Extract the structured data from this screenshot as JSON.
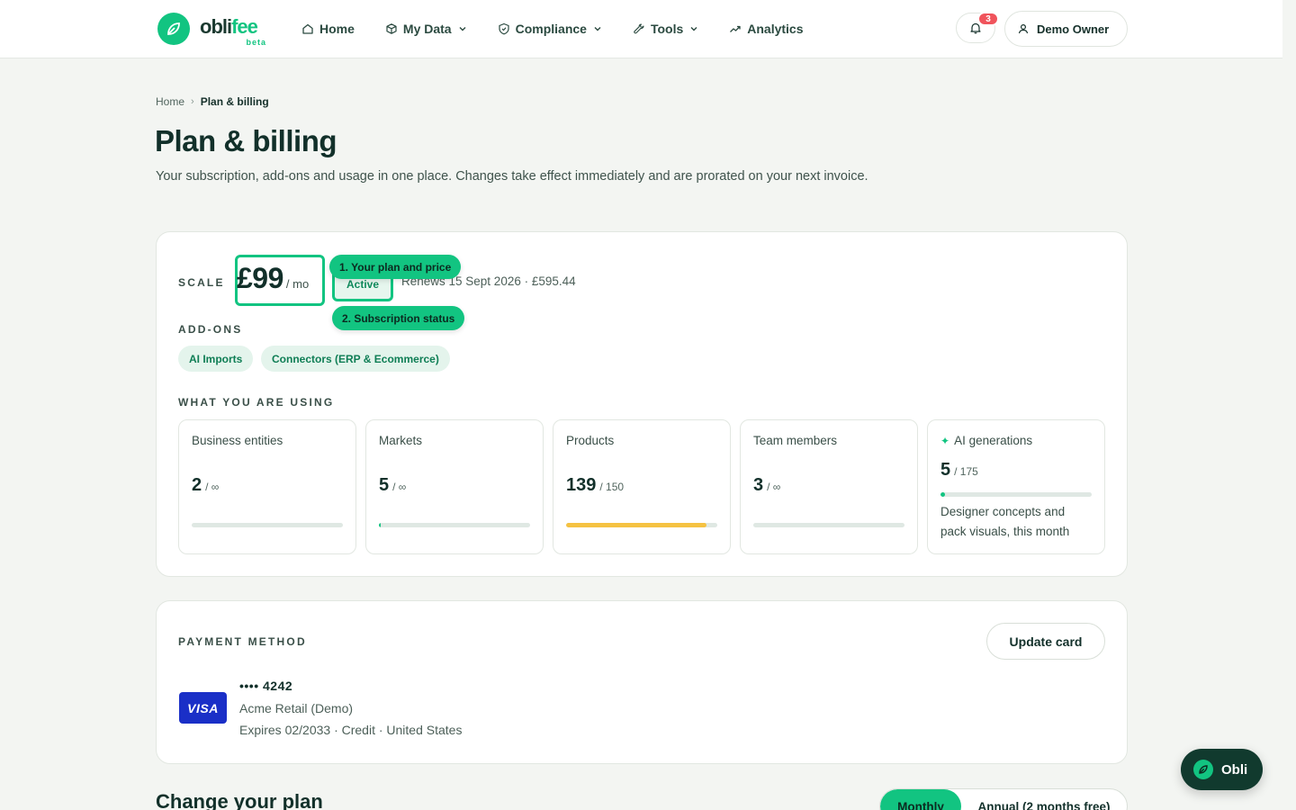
{
  "brand": {
    "name_prefix": "obli",
    "name_accent": "fee",
    "tag": "beta"
  },
  "nav": {
    "items": [
      {
        "label": "Home",
        "icon": "home-icon",
        "has_menu": false
      },
      {
        "label": "My Data",
        "icon": "cube-icon",
        "has_menu": true
      },
      {
        "label": "Compliance",
        "icon": "shield-icon",
        "has_menu": true
      },
      {
        "label": "Tools",
        "icon": "wrench-icon",
        "has_menu": true
      },
      {
        "label": "Analytics",
        "icon": "trend-up-icon",
        "has_menu": false
      }
    ],
    "notifications_count": "3",
    "user_name": "Demo Owner"
  },
  "breadcrumb": {
    "home": "Home",
    "separator": "›",
    "current": "Plan & billing"
  },
  "page": {
    "title": "Plan & billing",
    "subtitle": "Your subscription, add-ons and usage in one place. Changes take effect immediately and are prorated on your next invoice."
  },
  "plan": {
    "name": "SCALE",
    "price": "£99",
    "period": "/ mo",
    "status": "Active",
    "renewal": "Renews 15 Sept 2026 · £595.44",
    "tooltip_plan": "1. Your plan and price",
    "tooltip_status": "2. Subscription status"
  },
  "addons": {
    "label": "ADD-ONS",
    "items": [
      "AI Imports",
      "Connectors (ERP & Ecommerce)"
    ]
  },
  "usage": {
    "label": "WHAT YOU ARE USING",
    "items": [
      {
        "name": "Business entities",
        "used": "2",
        "limit": "/ ∞",
        "fraction": 0,
        "bar_color": "#dfe8e3"
      },
      {
        "name": "Markets",
        "used": "5",
        "limit": "/ ∞",
        "fraction": 0.01,
        "bar_color": "#12c481"
      },
      {
        "name": "Products",
        "used": "139",
        "limit": "/ 150",
        "fraction": 0.93,
        "bar_color": "#f5c242"
      },
      {
        "name": "Team members",
        "used": "3",
        "limit": "/ ∞",
        "fraction": 0,
        "bar_color": "#dfe8e3"
      }
    ],
    "ai": {
      "icon": "sparkle-icon",
      "name": "AI generations",
      "used": "5",
      "limit": "/ 175",
      "fraction": 0.03,
      "bar_color": "#12c481",
      "note": "Designer concepts and pack visuals, this month"
    }
  },
  "payment": {
    "label": "PAYMENT METHOD",
    "update_label": "Update card",
    "brand": "VISA",
    "number": "•••• 4242",
    "holder": "Acme Retail (Demo)",
    "details": "Expires 02/2033 · Credit · United States"
  },
  "change_plan": {
    "title": "Change your plan",
    "billing_options": [
      "Monthly",
      "Annual (2 months free)"
    ]
  },
  "assistant": {
    "label": "Obli"
  },
  "colors": {
    "accent": "#12c481",
    "dark": "#12302a",
    "warning": "#f5c242",
    "visa": "#1a2fc7",
    "badge": "#f0545c"
  }
}
